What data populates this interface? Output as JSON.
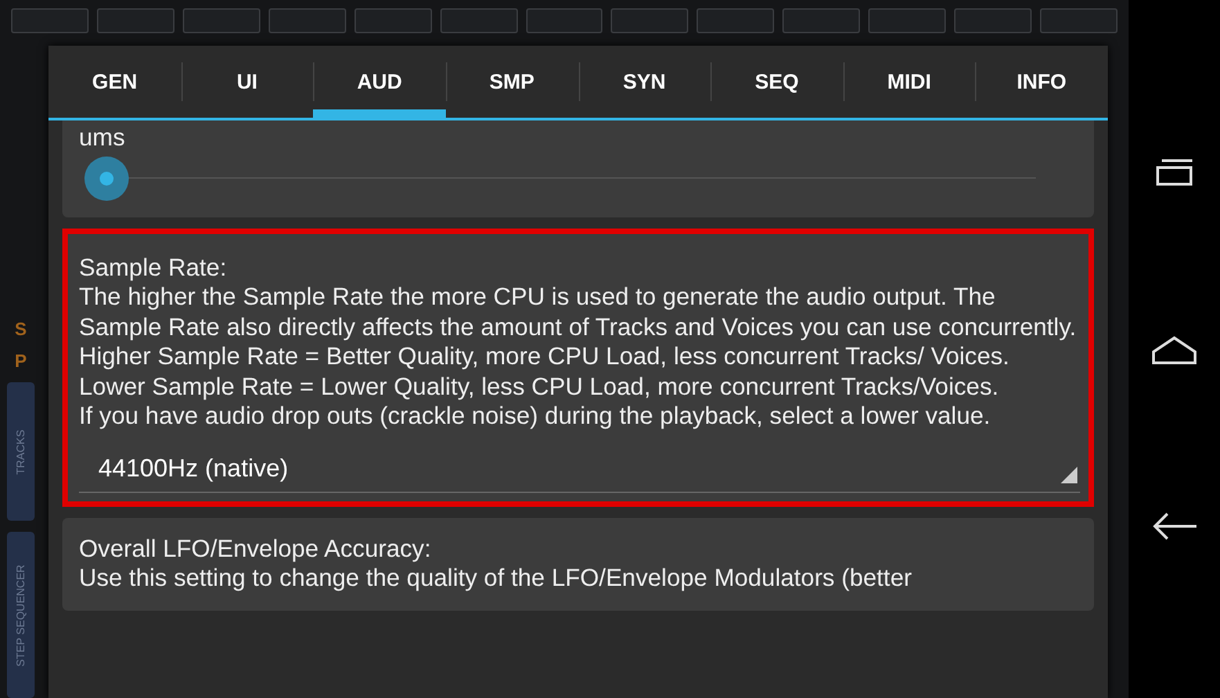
{
  "background_app": {
    "side_letters": [
      "S",
      "P"
    ],
    "side_tabs": [
      "TRACKS",
      "STEP SEQUENCER"
    ]
  },
  "dialog": {
    "tabs": [
      {
        "label": "GEN",
        "selected": false
      },
      {
        "label": "UI",
        "selected": false
      },
      {
        "label": "AUD",
        "selected": true
      },
      {
        "label": "SMP",
        "selected": false
      },
      {
        "label": "SYN",
        "selected": false
      },
      {
        "label": "SEQ",
        "selected": false
      },
      {
        "label": "MIDI",
        "selected": false
      },
      {
        "label": "INFO",
        "selected": false
      }
    ],
    "settings": [
      {
        "kind": "slider",
        "label": "ums",
        "highlighted": false
      },
      {
        "kind": "dropdown",
        "highlighted": true,
        "lines": [
          "Sample Rate:",
          "The higher the Sample Rate the more CPU is used to generate the audio output. The Sample Rate also directly affects the amount of Tracks and Voices you can use concurrently.",
          "Higher Sample Rate = Better Quality, more CPU Load, less concurrent Tracks/ Voices.",
          "Lower Sample Rate = Lower Quality, less CPU Load, more concurrent Tracks/Voices.",
          "If you have audio drop outs (crackle noise) during the playback, select a lower value."
        ],
        "value": "44100Hz (native)"
      },
      {
        "kind": "text",
        "highlighted": false,
        "lines": [
          "Overall LFO/Envelope Accuracy:",
          "Use this setting to change the quality of the LFO/Envelope Modulators (better"
        ]
      }
    ]
  }
}
